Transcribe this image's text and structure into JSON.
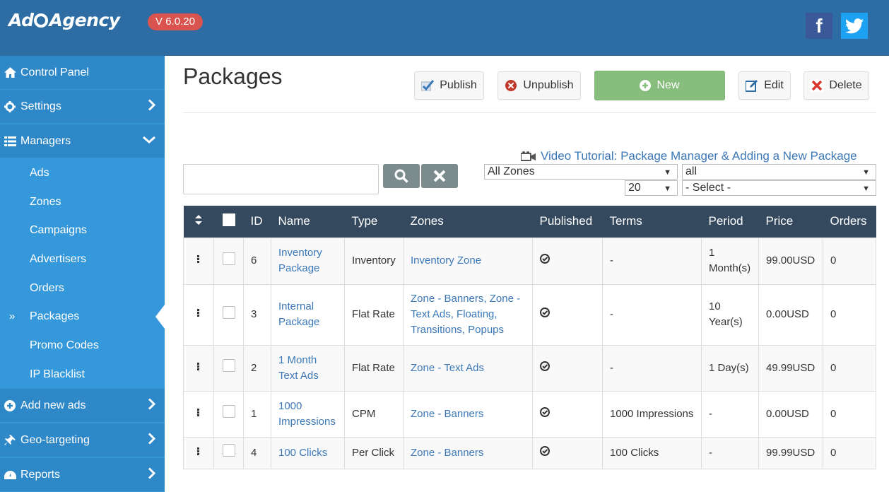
{
  "app": {
    "logo_left": "Ad",
    "logo_right": "Agency",
    "version": "V 6.0.20"
  },
  "sidebar": {
    "items": [
      {
        "label": "Control Panel",
        "icon": "home-icon"
      },
      {
        "label": "Settings",
        "icon": "gear-icon"
      },
      {
        "label": "Managers",
        "icon": "list-icon"
      },
      {
        "label": "Add new ads",
        "icon": "plus-circle-icon"
      },
      {
        "label": "Geo-targeting",
        "icon": "pin-icon"
      },
      {
        "label": "Reports",
        "icon": "dashboard-icon"
      }
    ],
    "submenu": [
      "Ads",
      "Zones",
      "Campaigns",
      "Advertisers",
      "Orders",
      "Packages",
      "Promo Codes",
      "IP Blacklist"
    ],
    "active_arrow": "»"
  },
  "page": {
    "title": "Packages",
    "toolbar": {
      "publish": "Publish",
      "unpublish": "Unpublish",
      "new": "New",
      "edit": "Edit",
      "delete": "Delete"
    },
    "video_link": "Video Tutorial: Package Manager & Adding a New Package"
  },
  "filters": {
    "search_value": "",
    "zones": "All Zones",
    "status": "all",
    "limit": "20",
    "select": "- Select -"
  },
  "table": {
    "headers": [
      "ID",
      "Name",
      "Type",
      "Zones",
      "Published",
      "Terms",
      "Period",
      "Price",
      "Orders"
    ],
    "rows": [
      {
        "id": "6",
        "name": "Inventory Package",
        "type": "Inventory",
        "zones": "Inventory Zone",
        "terms": "-",
        "period": "1 Month(s)",
        "price": "99.00USD",
        "orders": "0"
      },
      {
        "id": "3",
        "name": "Internal Package",
        "type": "Flat Rate",
        "zones": "Zone - Banners, Zone - Text Ads, Floating, Transitions, Popups",
        "terms": "-",
        "period": "10 Year(s)",
        "price": "0.00USD",
        "orders": "0"
      },
      {
        "id": "2",
        "name": "1 Month Text Ads",
        "type": "Flat Rate",
        "zones": "Zone - Text Ads",
        "terms": "-",
        "period": "1 Day(s)",
        "price": "49.99USD",
        "orders": "0"
      },
      {
        "id": "1",
        "name": "1000 Impressions",
        "type": "CPM",
        "zones": "Zone - Banners",
        "terms": "1000 Impressions",
        "period": "-",
        "price": "0.00USD",
        "orders": "0"
      },
      {
        "id": "4",
        "name": "100 Clicks",
        "type": "Per Click",
        "zones": "Zone - Banners",
        "terms": "100 Clicks",
        "period": "-",
        "price": "99.99USD",
        "orders": "0"
      }
    ]
  }
}
